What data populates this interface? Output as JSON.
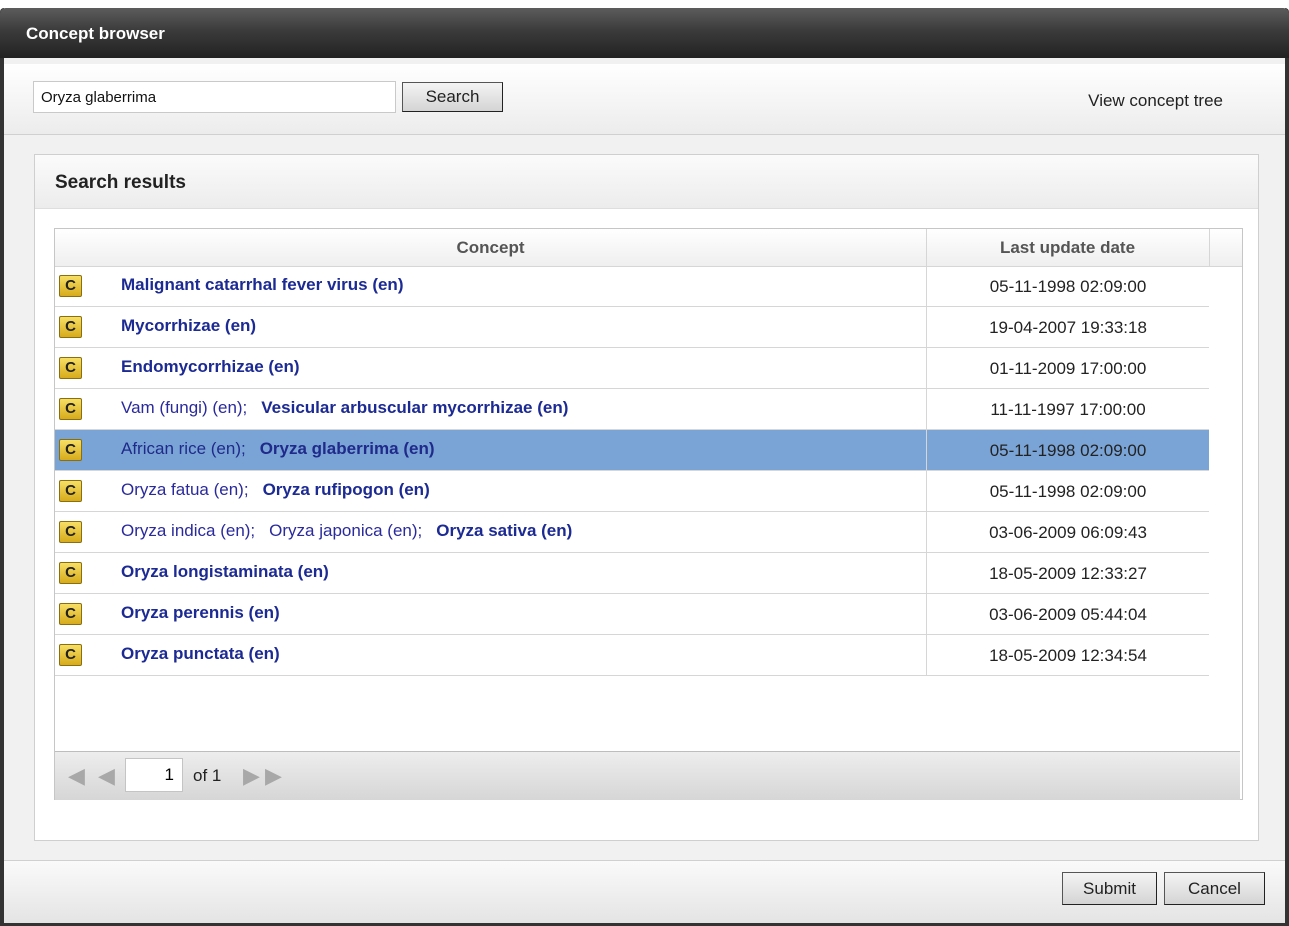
{
  "window": {
    "title": "Concept browser"
  },
  "toolbar": {
    "search_value": "Oryza glaberrima",
    "search_label": "Search",
    "tree_link": "View concept tree"
  },
  "results": {
    "title": "Search results",
    "columns": {
      "concept": "Concept",
      "date": "Last update date"
    },
    "icon_letter": "C",
    "selected_index": 4,
    "rows": [
      {
        "synonyms": [],
        "preferred": "Malignant catarrhal fever virus (en)",
        "date": "05-11-1998 02:09:00"
      },
      {
        "synonyms": [],
        "preferred": "Mycorrhizae (en)",
        "date": "19-04-2007 19:33:18"
      },
      {
        "synonyms": [],
        "preferred": "Endomycorrhizae (en)",
        "date": "01-11-2009 17:00:00"
      },
      {
        "synonyms": [
          "Vam (fungi) (en);"
        ],
        "preferred": "Vesicular arbuscular mycorrhizae (en)",
        "date": "11-11-1997 17:00:00"
      },
      {
        "synonyms": [
          "African rice (en);"
        ],
        "preferred": "Oryza glaberrima (en)",
        "date": "05-11-1998 02:09:00"
      },
      {
        "synonyms": [
          "Oryza fatua (en);"
        ],
        "preferred": "Oryza rufipogon (en)",
        "date": "05-11-1998 02:09:00"
      },
      {
        "synonyms": [
          "Oryza indica (en);",
          "Oryza japonica (en);"
        ],
        "preferred": "Oryza sativa (en)",
        "date": "03-06-2009 06:09:43"
      },
      {
        "synonyms": [],
        "preferred": "Oryza longistaminata (en)",
        "date": "18-05-2009 12:33:27"
      },
      {
        "synonyms": [],
        "preferred": "Oryza perennis (en)",
        "date": "03-06-2009 05:44:04"
      },
      {
        "synonyms": [],
        "preferred": "Oryza punctata (en)",
        "date": "18-05-2009 12:34:54"
      }
    ]
  },
  "pager": {
    "page": "1",
    "of_label": "of",
    "total": "1"
  },
  "footer": {
    "submit_label": "Submit",
    "cancel_label": "Cancel"
  },
  "icons": {
    "first": "first-page-icon",
    "prev": "prev-page-icon",
    "next": "next-page-icon",
    "last": "last-page-icon",
    "concept": "concept-icon"
  },
  "colors": {
    "selected_row": "#7aa4d6",
    "link": "#1c2a93",
    "titlebar": "#3b3b3b"
  }
}
